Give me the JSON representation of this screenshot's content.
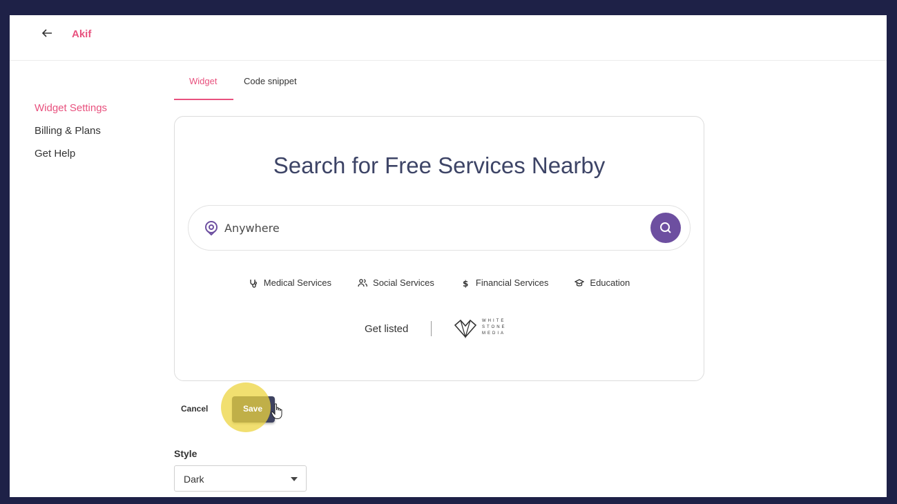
{
  "header": {
    "brand": "Akif"
  },
  "sidebar": {
    "items": [
      {
        "label": "Widget Settings",
        "active": true
      },
      {
        "label": "Billing & Plans",
        "active": false
      },
      {
        "label": "Get Help",
        "active": false
      }
    ]
  },
  "tabs": [
    {
      "label": "Widget",
      "active": true
    },
    {
      "label": "Code snippet",
      "active": false
    }
  ],
  "widget": {
    "title": "Search for Free Services Nearby",
    "search_value": "Anywhere",
    "categories": [
      {
        "label": "Medical Services",
        "icon": "stethoscope-icon"
      },
      {
        "label": "Social Services",
        "icon": "people-icon"
      },
      {
        "label": "Financial Services",
        "icon": "dollar-icon"
      },
      {
        "label": "Education",
        "icon": "graduation-cap-icon"
      }
    ],
    "get_listed": "Get listed",
    "logo_lines": [
      "WHITE",
      "STONE",
      "MEDIA"
    ]
  },
  "actions": {
    "cancel_label": "Cancel",
    "save_label": "Save"
  },
  "style": {
    "label": "Style",
    "value": "Dark"
  },
  "colors": {
    "accent": "#e8517e",
    "search_button": "#6d4fa0",
    "frame": "#1e2147",
    "highlight": "#ecd440"
  }
}
